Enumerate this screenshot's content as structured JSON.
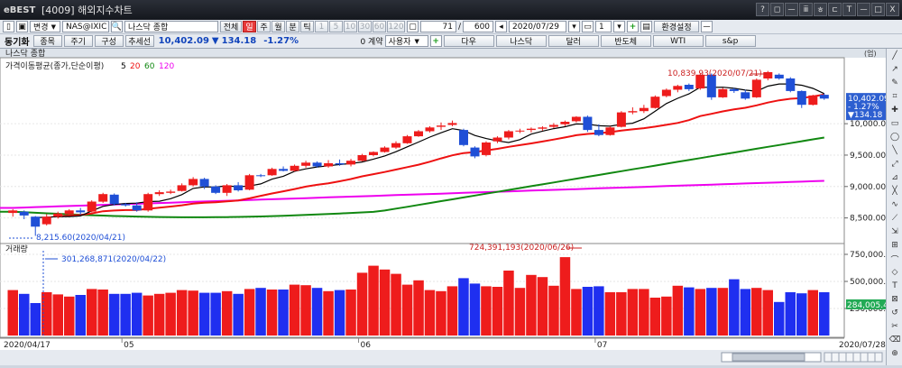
{
  "window": {
    "logo": "eBEST",
    "title": "[4009] 해외지수차트",
    "controls": [
      "?",
      "◻",
      "ㅡ",
      "ⅲ",
      "ㅎ",
      "ㄷ",
      "T",
      "ㅡ",
      "□",
      "X"
    ]
  },
  "toolbar1": {
    "change_label": "변경",
    "symbol": "NAS@IXIC",
    "symbol_name": "나스닥 종합",
    "period_buttons": [
      {
        "label": "전체",
        "active": false
      },
      {
        "label": "일",
        "active": true
      },
      {
        "label": "주",
        "active": false
      },
      {
        "label": "월",
        "active": false
      },
      {
        "label": "분",
        "active": false
      },
      {
        "label": "틱",
        "active": false
      },
      {
        "label": "1",
        "active": false,
        "disabled": true
      },
      {
        "label": "5",
        "active": false,
        "disabled": true
      },
      {
        "label": "10",
        "active": false,
        "disabled": true
      },
      {
        "label": "30",
        "active": false,
        "disabled": true
      },
      {
        "label": "60",
        "active": false,
        "disabled": true
      },
      {
        "label": "120",
        "active": false,
        "disabled": true
      }
    ],
    "count_value": "71",
    "total_value": "600",
    "date_value": "2020/07/29",
    "screen_count": "1",
    "settings_label": "환경설정"
  },
  "toolbar2": {
    "tag": "동기화",
    "tabs": [
      "종목",
      "주기",
      "구성",
      "추세선"
    ],
    "price": "10,402.09",
    "change": "134.18",
    "change_pct": "-1.27%",
    "count_label": "0 계약",
    "user_label": "사용자",
    "quick_buttons": [
      "다우",
      "나스닥",
      "달러",
      "반도체",
      "WTI",
      "s&p"
    ]
  },
  "chart": {
    "header_title": "나스닥 종합",
    "header_right": "(엄)",
    "legend_title": "가격이동평균(종가,단순이평)",
    "ma_periods": [
      "5",
      "20",
      "60",
      "120"
    ],
    "ma_colors": [
      "#000000",
      "#ee1111",
      "#118811",
      "#ee00ee"
    ],
    "price_ticks": [
      "10,000.00",
      "9,500.00",
      "9,000.00",
      "8,500.00"
    ],
    "current_price_tag": [
      "10,402.09",
      "- 1.27%",
      "▼134.18"
    ],
    "high_annotation": "10,839.93(2020/07/21)",
    "low_annotation": "8,215.60(2020/04/21)",
    "volume_title": "거래량",
    "volume_ticks": [
      "750,000.00",
      "500,000.00",
      "250,000.00"
    ],
    "volume_current_tag": "284,005.47",
    "volume_high_annotation": "724,391,193(2020/06/26)",
    "volume_low_annotation": "301,268,871(2020/04/22)",
    "x_start": "2020/04/17",
    "x_end": "2020/07/28",
    "month_labels": [
      "05",
      "06",
      "07"
    ]
  },
  "chart_data": {
    "type": "candlestick",
    "title": "나스닥 종합",
    "x_start": "2020/04/17",
    "x_end": "2020/07/28",
    "ylim": [
      8150,
      11050
    ],
    "volume_ylim": [
      0,
      800000000
    ],
    "candles": [
      {
        "o": 8580,
        "h": 8640,
        "l": 8520,
        "c": 8620
      },
      {
        "o": 8600,
        "h": 8620,
        "l": 8480,
        "c": 8540
      },
      {
        "o": 8520,
        "h": 8530,
        "l": 8215,
        "c": 8360
      },
      {
        "o": 8400,
        "h": 8560,
        "l": 8380,
        "c": 8520
      },
      {
        "o": 8520,
        "h": 8600,
        "l": 8490,
        "c": 8570
      },
      {
        "o": 8560,
        "h": 8640,
        "l": 8540,
        "c": 8620
      },
      {
        "o": 8620,
        "h": 8660,
        "l": 8550,
        "c": 8590
      },
      {
        "o": 8600,
        "h": 8780,
        "l": 8590,
        "c": 8760
      },
      {
        "o": 8760,
        "h": 8900,
        "l": 8740,
        "c": 8880
      },
      {
        "o": 8870,
        "h": 8890,
        "l": 8700,
        "c": 8720
      },
      {
        "o": 8720,
        "h": 8740,
        "l": 8680,
        "c": 8700
      },
      {
        "o": 8700,
        "h": 8750,
        "l": 8600,
        "c": 8620
      },
      {
        "o": 8620,
        "h": 8900,
        "l": 8600,
        "c": 8880
      },
      {
        "o": 8880,
        "h": 8940,
        "l": 8850,
        "c": 8910
      },
      {
        "o": 8900,
        "h": 8950,
        "l": 8880,
        "c": 8920
      },
      {
        "o": 8930,
        "h": 9050,
        "l": 8920,
        "c": 9020
      },
      {
        "o": 9020,
        "h": 9150,
        "l": 9000,
        "c": 9120
      },
      {
        "o": 9120,
        "h": 9140,
        "l": 8960,
        "c": 9000
      },
      {
        "o": 9000,
        "h": 9020,
        "l": 8880,
        "c": 8900
      },
      {
        "o": 8900,
        "h": 9040,
        "l": 8850,
        "c": 9020
      },
      {
        "o": 9020,
        "h": 9070,
        "l": 8920,
        "c": 8940
      },
      {
        "o": 8950,
        "h": 9200,
        "l": 8940,
        "c": 9180
      },
      {
        "o": 9180,
        "h": 9200,
        "l": 9150,
        "c": 9170
      },
      {
        "o": 9180,
        "h": 9300,
        "l": 9170,
        "c": 9280
      },
      {
        "o": 9280,
        "h": 9320,
        "l": 9240,
        "c": 9250
      },
      {
        "o": 9250,
        "h": 9350,
        "l": 9240,
        "c": 9330
      },
      {
        "o": 9330,
        "h": 9410,
        "l": 9300,
        "c": 9380
      },
      {
        "o": 9380,
        "h": 9400,
        "l": 9300,
        "c": 9320
      },
      {
        "o": 9320,
        "h": 9420,
        "l": 9300,
        "c": 9370
      },
      {
        "o": 9370,
        "h": 9430,
        "l": 9330,
        "c": 9350
      },
      {
        "o": 9350,
        "h": 9440,
        "l": 9320,
        "c": 9410
      },
      {
        "o": 9410,
        "h": 9520,
        "l": 9400,
        "c": 9500
      },
      {
        "o": 9500,
        "h": 9560,
        "l": 9480,
        "c": 9550
      },
      {
        "o": 9550,
        "h": 9640,
        "l": 9540,
        "c": 9620
      },
      {
        "o": 9620,
        "h": 9720,
        "l": 9600,
        "c": 9690
      },
      {
        "o": 9690,
        "h": 9820,
        "l": 9680,
        "c": 9800
      },
      {
        "o": 9800,
        "h": 9900,
        "l": 9790,
        "c": 9880
      },
      {
        "o": 9880,
        "h": 9960,
        "l": 9860,
        "c": 9940
      },
      {
        "o": 9950,
        "h": 10020,
        "l": 9900,
        "c": 9970
      },
      {
        "o": 9980,
        "h": 10050,
        "l": 9960,
        "c": 10010
      },
      {
        "o": 9900,
        "h": 9920,
        "l": 9640,
        "c": 9660
      },
      {
        "o": 9620,
        "h": 9640,
        "l": 9450,
        "c": 9480
      },
      {
        "o": 9500,
        "h": 9720,
        "l": 9480,
        "c": 9700
      },
      {
        "o": 9720,
        "h": 9800,
        "l": 9690,
        "c": 9780
      },
      {
        "o": 9780,
        "h": 9900,
        "l": 9750,
        "c": 9880
      },
      {
        "o": 9880,
        "h": 9920,
        "l": 9850,
        "c": 9890
      },
      {
        "o": 9900,
        "h": 9940,
        "l": 9860,
        "c": 9920
      },
      {
        "o": 9920,
        "h": 9960,
        "l": 9890,
        "c": 9940
      },
      {
        "o": 9950,
        "h": 10010,
        "l": 9930,
        "c": 9980
      },
      {
        "o": 9990,
        "h": 10050,
        "l": 9960,
        "c": 10030
      },
      {
        "o": 10040,
        "h": 10120,
        "l": 10020,
        "c": 10110
      },
      {
        "o": 10110,
        "h": 10130,
        "l": 9870,
        "c": 9900
      },
      {
        "o": 9900,
        "h": 9990,
        "l": 9800,
        "c": 9820
      },
      {
        "o": 9820,
        "h": 9960,
        "l": 9810,
        "c": 9940
      },
      {
        "o": 9950,
        "h": 10200,
        "l": 9940,
        "c": 10180
      },
      {
        "o": 10180,
        "h": 10260,
        "l": 10150,
        "c": 10200
      },
      {
        "o": 10200,
        "h": 10300,
        "l": 10170,
        "c": 10250
      },
      {
        "o": 10250,
        "h": 10450,
        "l": 10240,
        "c": 10430
      },
      {
        "o": 10440,
        "h": 10560,
        "l": 10420,
        "c": 10540
      },
      {
        "o": 10540,
        "h": 10620,
        "l": 10500,
        "c": 10600
      },
      {
        "o": 10620,
        "h": 10640,
        "l": 10520,
        "c": 10550
      },
      {
        "o": 10560,
        "h": 10800,
        "l": 10540,
        "c": 10780
      },
      {
        "o": 10780,
        "h": 10800,
        "l": 10380,
        "c": 10420
      },
      {
        "o": 10420,
        "h": 10570,
        "l": 10410,
        "c": 10550
      },
      {
        "o": 10550,
        "h": 10570,
        "l": 10490,
        "c": 10520
      },
      {
        "o": 10500,
        "h": 10540,
        "l": 10380,
        "c": 10400
      },
      {
        "o": 10420,
        "h": 10720,
        "l": 10410,
        "c": 10700
      },
      {
        "o": 10720,
        "h": 10840,
        "l": 10690,
        "c": 10820
      },
      {
        "o": 10780,
        "h": 10800,
        "l": 10700,
        "c": 10720
      },
      {
        "o": 10720,
        "h": 10740,
        "l": 10500,
        "c": 10520
      },
      {
        "o": 10520,
        "h": 10530,
        "l": 10250,
        "c": 10300
      },
      {
        "o": 10300,
        "h": 10460,
        "l": 10290,
        "c": 10450
      },
      {
        "o": 10460,
        "h": 10480,
        "l": 10380,
        "c": 10400
      }
    ],
    "volumes": [
      420,
      385,
      300,
      400,
      380,
      360,
      375,
      430,
      425,
      385,
      385,
      395,
      370,
      385,
      395,
      420,
      415,
      395,
      395,
      410,
      385,
      430,
      440,
      425,
      425,
      470,
      465,
      440,
      410,
      420,
      425,
      580,
      645,
      610,
      570,
      470,
      510,
      420,
      410,
      455,
      530,
      480,
      455,
      450,
      600,
      440,
      560,
      540,
      460,
      724,
      430,
      450,
      455,
      400,
      400,
      430,
      430,
      350,
      360,
      460,
      445,
      430,
      440,
      440,
      520,
      430,
      440,
      420,
      310,
      400,
      390,
      420,
      400
    ],
    "volume_colors_up": [
      "#ee1c1c"
    ],
    "ma_series": [
      "MA5",
      "MA20",
      "MA60",
      "MA120"
    ]
  }
}
